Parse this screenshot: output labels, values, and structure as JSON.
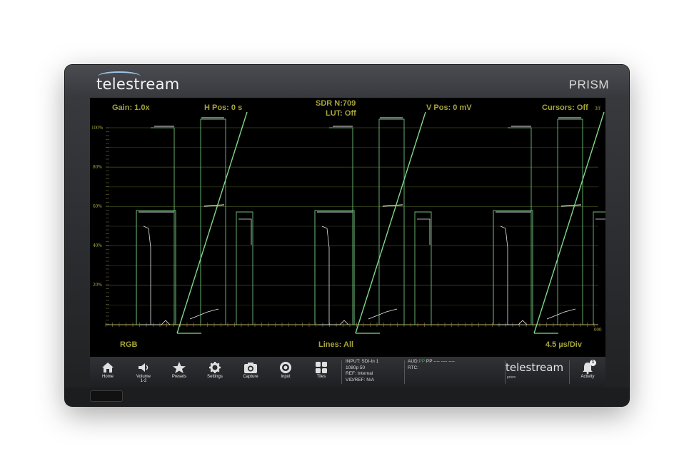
{
  "device": {
    "brand": "telestream",
    "model": "PRISM"
  },
  "hud": {
    "gain": "Gain: 1.0x",
    "hpos": "H Pos: 0 s",
    "sdr": "SDR N:709",
    "lut": "LUT: Off",
    "vpos": "V Pos: 0 mV",
    "cursors": "Cursors: Off",
    "mode": "RGB",
    "lines": "Lines: All",
    "timebase": "4.5 µs/Div",
    "tick_top_right": "3ff",
    "tick_bottom_right": "000"
  },
  "scale_labels": [
    "100%",
    "80%",
    "60%",
    "40%",
    "20%"
  ],
  "toolbar": {
    "items": [
      {
        "label": "Home",
        "icon": "home-icon"
      },
      {
        "label": "Volume",
        "sub": "1-2",
        "icon": "speaker-icon"
      },
      {
        "label": "Presets",
        "icon": "star-icon"
      },
      {
        "label": "Settings",
        "icon": "gear-icon"
      },
      {
        "label": "Capture",
        "icon": "camera-icon"
      },
      {
        "label": "Input",
        "icon": "input-icon"
      },
      {
        "label": "Tiles",
        "icon": "tiles-icon"
      }
    ],
    "input_info": [
      "INPUT: SDI-In 1",
      "1080p 50",
      "REF: Internal",
      "VID/REF: N/A"
    ],
    "aud_label": "AUD:",
    "aud_value": "PP ---- ---- ----",
    "rtc": "RTC:",
    "logo": "telestream",
    "logo_sub": "prism",
    "activity_label": "Activity",
    "activity_count": "1"
  },
  "colors": {
    "trace": "#7fd88a",
    "hud_text": "#a7a43c",
    "screen_bg": "#000000"
  }
}
